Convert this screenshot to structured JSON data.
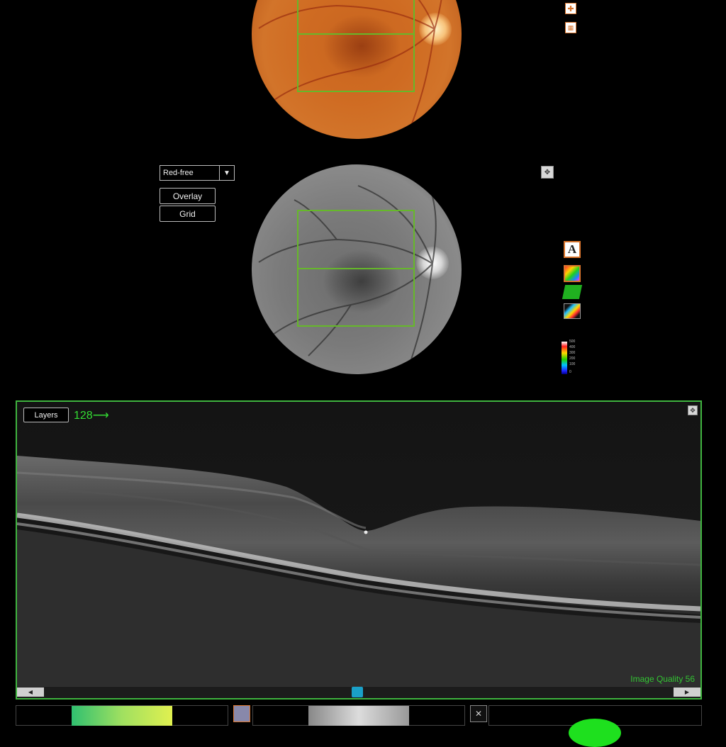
{
  "controls": {
    "image_mode_selected": "Red-free",
    "overlay_label": "Overlay",
    "grid_label": "Grid"
  },
  "side_tools": {
    "top_icons": [
      "flag-icon",
      "grid-icon"
    ],
    "tool_icons": [
      "text-annotation-icon",
      "thickness-map-icon",
      "surface-3d-icon",
      "volume-3d-icon"
    ],
    "expand_icon": "expand-icon"
  },
  "color_scale": {
    "labels": [
      "500",
      "400",
      "300",
      "200",
      "100",
      "0"
    ],
    "colors": [
      "#ffffff",
      "#ff2020",
      "#ffd800",
      "#21d000",
      "#00c0ff",
      "#2020ff"
    ]
  },
  "oct": {
    "layers_label": "Layers",
    "slice_number": "128",
    "image_quality": "Image Quality 56",
    "frame_color": "#3fb43f"
  }
}
